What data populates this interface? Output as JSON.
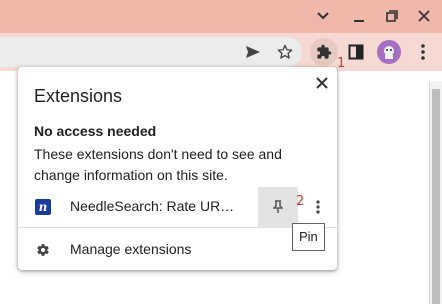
{
  "window": {
    "controls": [
      "chevron-down-icon",
      "minimize-icon",
      "restore-icon",
      "close-icon"
    ]
  },
  "toolbar": {
    "icons": [
      "share-arrow-icon",
      "star-icon",
      "puzzle-icon",
      "sidepanel-icon",
      "avatar",
      "kebab-icon"
    ]
  },
  "annotations": {
    "one": "1",
    "two": "2"
  },
  "popup": {
    "title": "Extensions",
    "section_heading": "No access needed",
    "section_description": "These extensions don't need to see and change information on this site.",
    "extensions": [
      {
        "logo_letter": "n",
        "name": "NeedleSearch: Rate UR…"
      }
    ],
    "manage_label": "Manage extensions"
  },
  "tooltip": {
    "text": "Pin"
  },
  "colors": {
    "titlebar": "#f0b8aa",
    "toolbar": "#f5d9d2",
    "logo_bg": "#1a3a9c",
    "avatar_bg": "#a46fc1",
    "annotation": "#d23a2a"
  }
}
